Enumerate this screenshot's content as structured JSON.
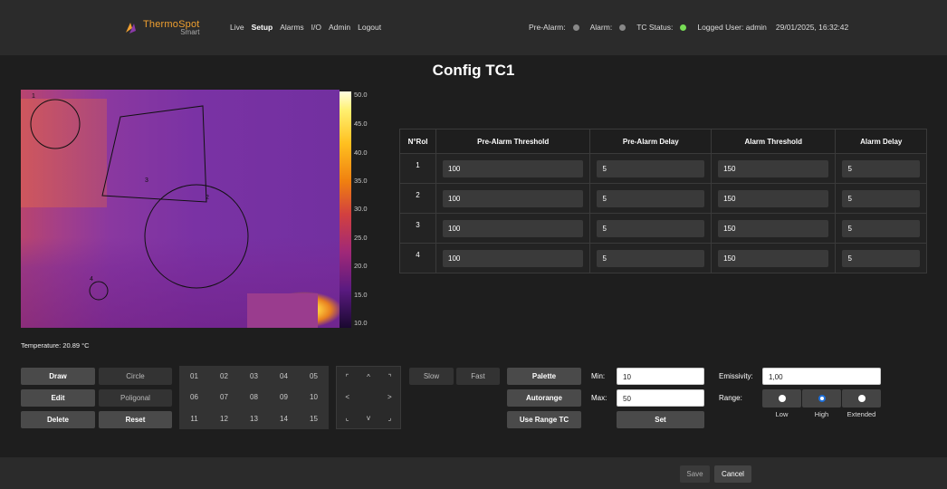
{
  "header": {
    "logo_line1": "ThermoSpot",
    "logo_line2": "Smart",
    "nav": [
      "Live",
      "Setup",
      "Alarms",
      "I/O",
      "Admin",
      "Logout"
    ],
    "status": {
      "pre_alarm_label": "Pre-Alarm:",
      "alarm_label": "Alarm:",
      "tc_status_label": "TC Status:",
      "logged_user": "Logged User: admin",
      "datetime": "29/01/2025, 16:32:42",
      "pre_alarm_color": "#888888",
      "alarm_color": "#888888",
      "tc_status_color": "#77dd55"
    }
  },
  "page_title": "Config TC1",
  "thermal": {
    "roi_labels": [
      "1",
      "2",
      "3",
      "4"
    ],
    "colorbar_ticks": [
      "50.0",
      "45.0",
      "40.0",
      "35.0",
      "30.0",
      "25.0",
      "20.0",
      "15.0",
      "10.0"
    ],
    "temperature_readout": "Temperature: 20.89 °C"
  },
  "roi_table": {
    "headers": [
      "N°RoI",
      "Pre-Alarm Threshold",
      "Pre-Alarm Delay",
      "Alarm Threshold",
      "Alarm Delay"
    ],
    "rows": [
      {
        "n": "1",
        "pre_th": "100",
        "pre_delay": "5",
        "alarm_th": "150",
        "alarm_delay": "5"
      },
      {
        "n": "2",
        "pre_th": "100",
        "pre_delay": "5",
        "alarm_th": "150",
        "alarm_delay": "5"
      },
      {
        "n": "3",
        "pre_th": "100",
        "pre_delay": "5",
        "alarm_th": "150",
        "alarm_delay": "5"
      },
      {
        "n": "4",
        "pre_th": "100",
        "pre_delay": "5",
        "alarm_th": "150",
        "alarm_delay": "5"
      }
    ]
  },
  "tools": {
    "draw": "Draw",
    "circle": "Circle",
    "edit": "Edit",
    "poligonal": "Poligonal",
    "delete": "Delete",
    "reset": "Reset",
    "numbers": [
      "01",
      "02",
      "03",
      "04",
      "05",
      "06",
      "07",
      "08",
      "09",
      "10",
      "11",
      "12",
      "13",
      "14",
      "15"
    ],
    "arrows": [
      "⌜",
      "^",
      "⌝",
      "<",
      "",
      ">",
      "⌞",
      "v",
      "⌟"
    ],
    "slow": "Slow",
    "fast": "Fast",
    "palette": "Palette",
    "autorange": "Autorange",
    "use_range_tc": "Use Range TC",
    "min_label": "Min:",
    "min_value": "10",
    "max_label": "Max:",
    "max_value": "50",
    "set": "Set",
    "emissivity_label": "Emissivity:",
    "emissivity_value": "1,00",
    "range_label": "Range:",
    "range_options": [
      "Low",
      "High",
      "Extended"
    ],
    "range_selected": "High"
  },
  "footer": {
    "save": "Save",
    "cancel": "Cancel"
  }
}
